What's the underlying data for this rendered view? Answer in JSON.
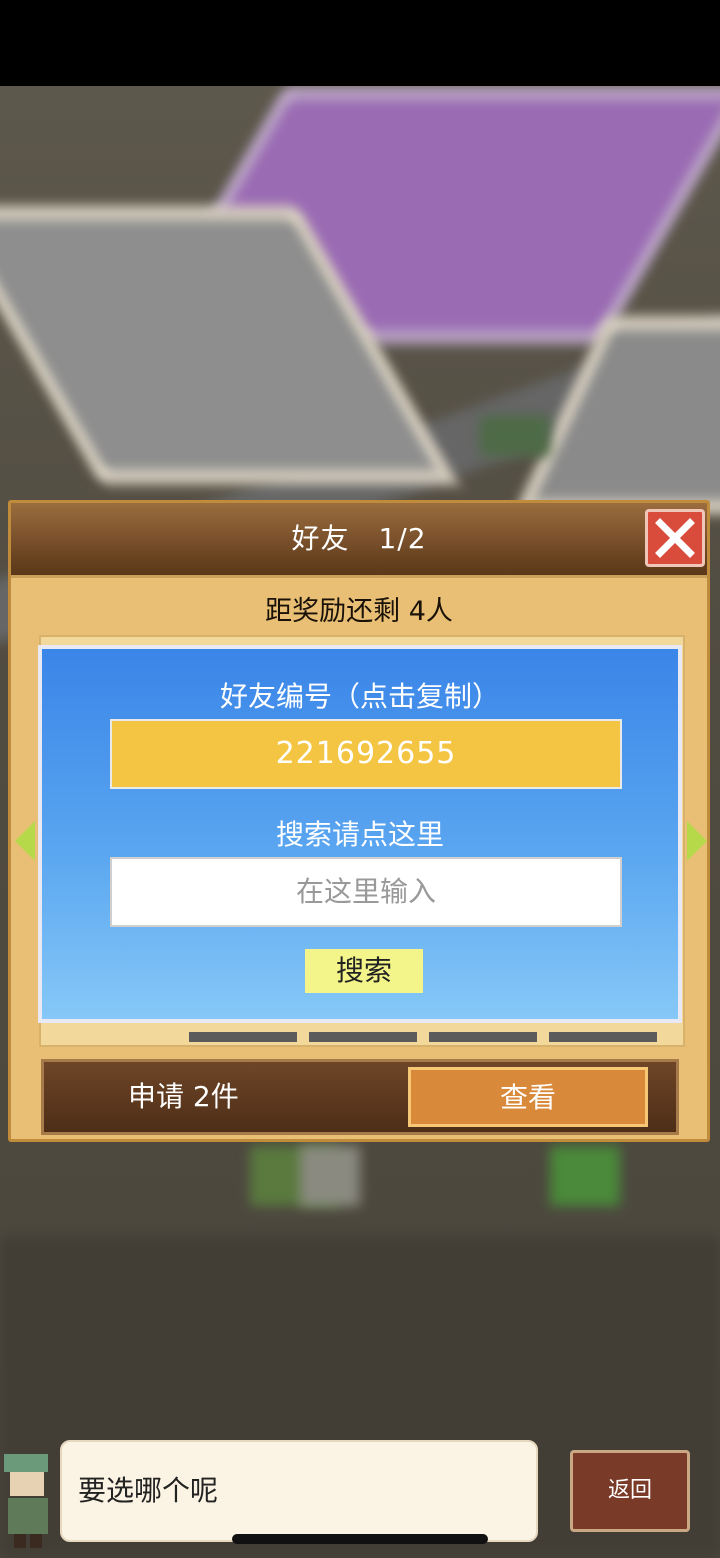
{
  "dialog": {
    "title": "好友　1/2",
    "reward_remaining": "距奖励还剩 4人"
  },
  "popup": {
    "friend_id_label": "好友编号（点击复制）",
    "friend_id": "221692655",
    "search_label": "搜索请点这里",
    "search_placeholder": "在这里输入",
    "search_button": "搜索"
  },
  "requests": {
    "label": "申请 2件",
    "view_button": "查看"
  },
  "footer": {
    "speech": "要选哪个呢",
    "back_button": "返回"
  },
  "colors": {
    "dialog_bg": "#e8bf74",
    "popup_top": "#3a85e8",
    "code_box": "#f4c542",
    "search_button": "#f3f58a",
    "view_button": "#d9893a",
    "close_button": "#d94b3a"
  },
  "icons": [
    "close-icon",
    "arrow-left-icon",
    "arrow-right-icon"
  ]
}
